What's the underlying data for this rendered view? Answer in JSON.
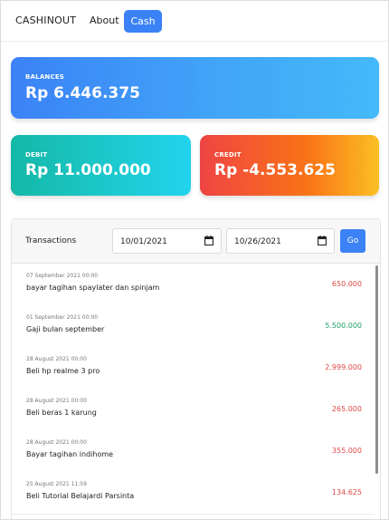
{
  "nav": {
    "brand": "CASHINOUT",
    "about": "About",
    "cash": "Cash"
  },
  "colors": {
    "accent": "#3b82f6",
    "income": "#22a06b",
    "expense": "#e04848"
  },
  "balances": {
    "label": "BALANCES",
    "value": "Rp 6.446.375"
  },
  "debit": {
    "label": "DEBIT",
    "value": "Rp 11.000.000"
  },
  "credit": {
    "label": "CREDIT",
    "value": "Rp -4.553.625"
  },
  "transactions": {
    "title": "Transactions",
    "date_from": "10/01/2021",
    "date_to": "10/26/2021",
    "go_label": "Go",
    "items": [
      {
        "time": "07 September 2021 00:00",
        "desc": "bayar tagihan spaylater dan spinjam",
        "amount": "650.000",
        "type": "expense"
      },
      {
        "time": "01 September 2021 00:00",
        "desc": "Gaji bulan september",
        "amount": "5.500.000",
        "type": "income"
      },
      {
        "time": "28 August 2021 00:00",
        "desc": "Beli hp realme 3 pro",
        "amount": "2.999.000",
        "type": "expense"
      },
      {
        "time": "28 August 2021 00:00",
        "desc": "Beli beras 1 karung",
        "amount": "265.000",
        "type": "expense"
      },
      {
        "time": "28 August 2021 00:00",
        "desc": "Bayar tagihan indihome",
        "amount": "355.000",
        "type": "expense"
      },
      {
        "time": "25 August 2021 11:59",
        "desc": "Beli Tutorial Belajardi Parsinta",
        "amount": "134.625",
        "type": "expense"
      }
    ]
  }
}
